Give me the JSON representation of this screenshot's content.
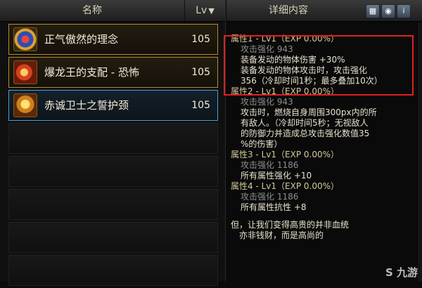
{
  "left_header": {
    "name": "名称",
    "lv": "Lv",
    "sort_icon": "triangle-down-icon"
  },
  "items": [
    {
      "name": "正气傲然的理念",
      "level": "105"
    },
    {
      "name": "爆龙王的支配 - 恐怖",
      "level": "105"
    },
    {
      "name": "赤诚卫士之誓护颈",
      "level": "105"
    }
  ],
  "right_header": {
    "title": "详细内容"
  },
  "detail": {
    "a1_title": "属性1 - Lv1（EXP 0.00%）",
    "a1_stat": "攻击强化 943",
    "a1_e1": "装备发动的物体伤害 +30%",
    "a1_e2": "装备发动的物体攻击时，攻击强化",
    "a1_e3": "356（冷却时间1秒；最多叠加10次）",
    "a2_title": "属性2 - Lv1（EXP 0.00%）",
    "a2_stat": "攻击强化 943",
    "a2_e1": "攻击时，燃烧自身周围300px内的所",
    "a2_e2": "有敌人。（冷却时间5秒；无视敌人",
    "a2_e3": "的防御力并造成总攻击强化数值35",
    "a2_e4": "%的伤害）",
    "a3_title": "属性3 - Lv1（EXP 0.00%）",
    "a3_stat": "攻击强化 1186",
    "a3_e1": "所有属性强化 +10",
    "a4_title": "属性4 - Lv1（EXP 0.00%）",
    "a4_stat": "攻击强化 1186",
    "a4_e1": "所有属性抗性 +8",
    "flavor1": "但，让我们变得高贵的并非血统",
    "flavor2": "亦非钱财，而是高尚的"
  },
  "watermark": "九游"
}
